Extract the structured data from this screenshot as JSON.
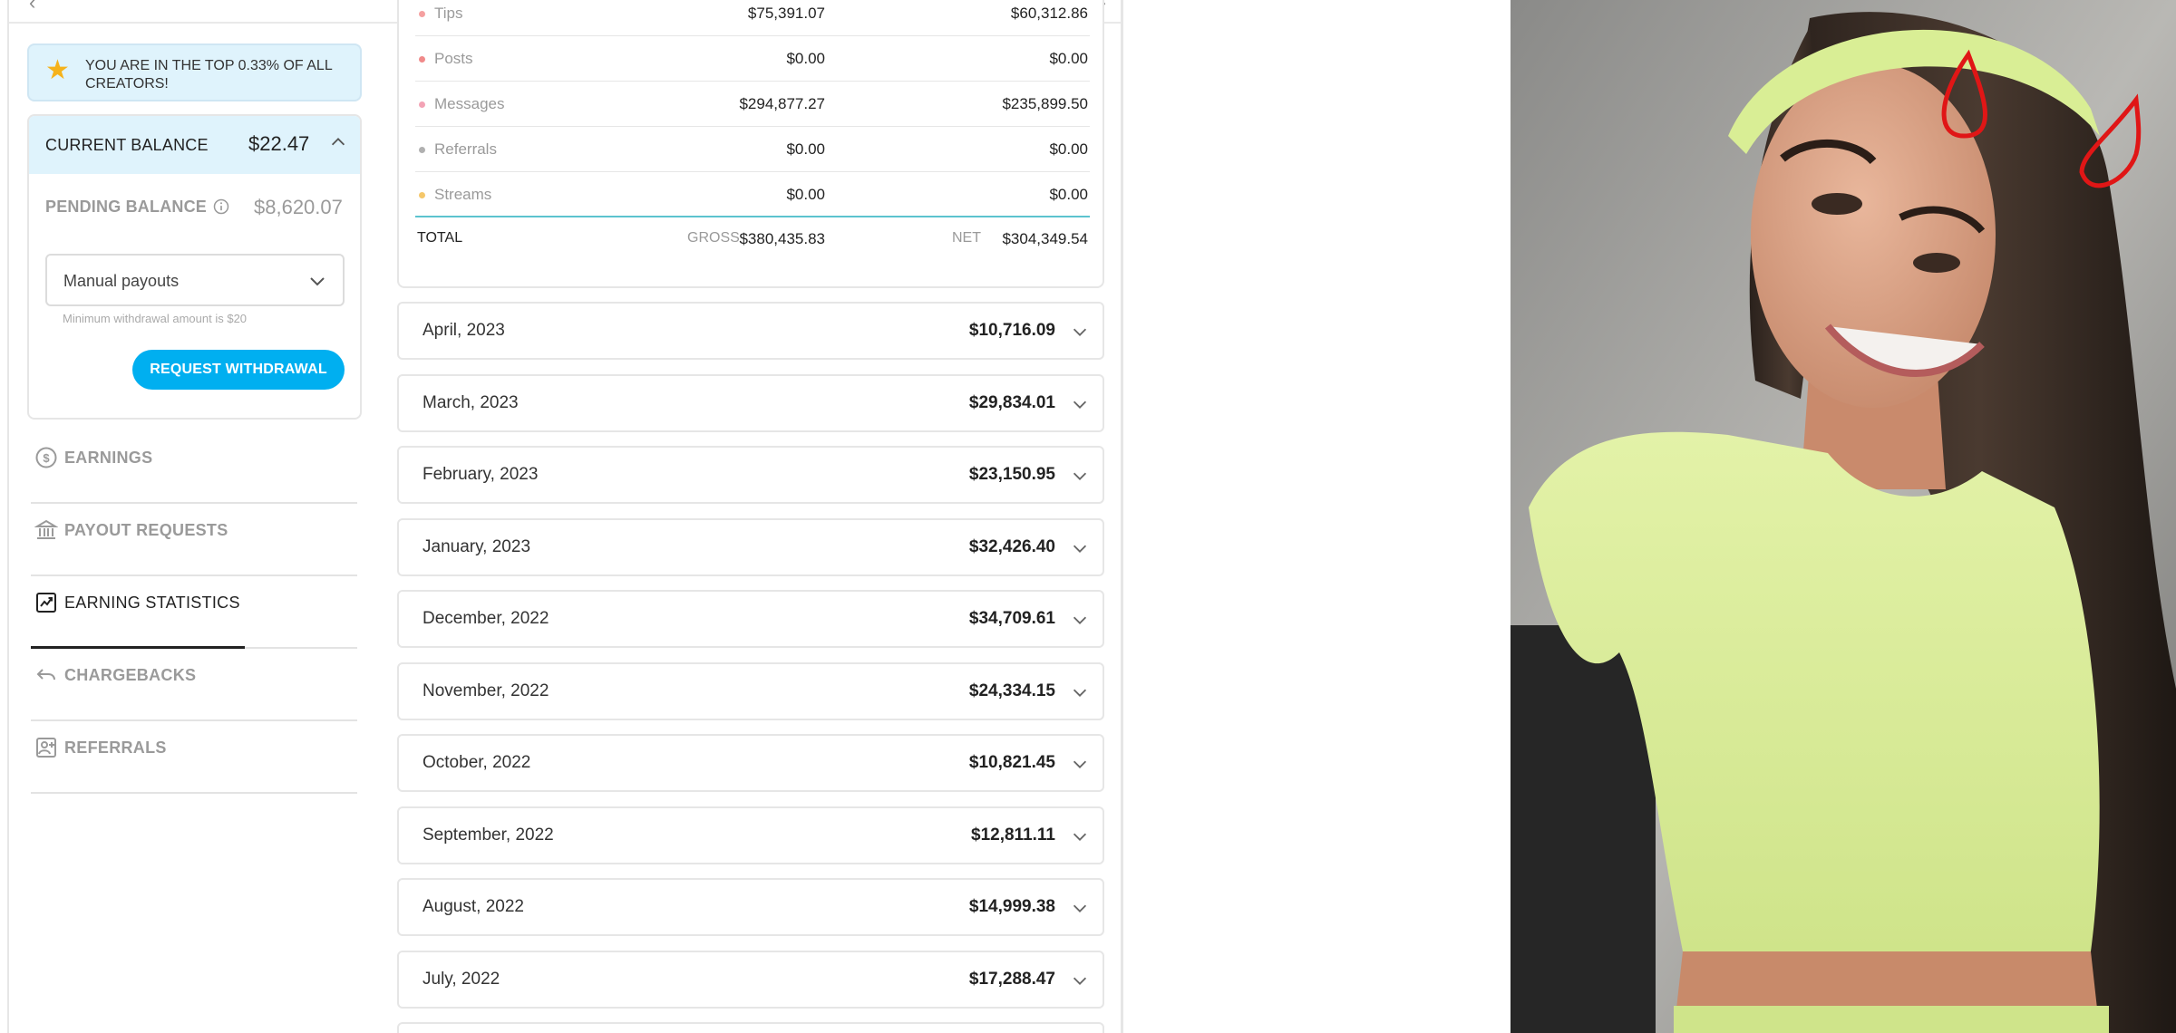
{
  "promo": {
    "text": "YOU ARE IN THE TOP 0.33% OF ALL CREATORS!"
  },
  "balance": {
    "current_label": "CURRENT BALANCE",
    "current_amount": "$22.47",
    "pending_label": "PENDING BALANCE",
    "pending_amount": "$8,620.07",
    "payout_mode": "Manual payouts",
    "min_hint": "Minimum withdrawal amount is $20",
    "withdraw_label": "REQUEST WITHDRAWAL"
  },
  "nav": [
    {
      "label": "EARNINGS",
      "icon": "dollar-circle-icon",
      "active": false
    },
    {
      "label": "PAYOUT REQUESTS",
      "icon": "bank-icon",
      "active": false
    },
    {
      "label": "EARNING STATISTICS",
      "icon": "chart-icon",
      "active": true
    },
    {
      "label": "CHARGEBACKS",
      "icon": "undo-icon",
      "active": false
    },
    {
      "label": "REFERRALS",
      "icon": "referral-icon",
      "active": false
    }
  ],
  "categories": [
    {
      "name": "Tips",
      "gross": "$75,391.07",
      "net": "$60,312.86",
      "dot_color": "#f5a0a0"
    },
    {
      "name": "Posts",
      "gross": "$0.00",
      "net": "$0.00",
      "dot_color": "#f08a8a"
    },
    {
      "name": "Messages",
      "gross": "$294,877.27",
      "net": "$235,899.50",
      "dot_color": "#f3a3b5"
    },
    {
      "name": "Referrals",
      "gross": "$0.00",
      "net": "$0.00",
      "dot_color": "#b0b0b0"
    },
    {
      "name": "Streams",
      "gross": "$0.00",
      "net": "$0.00",
      "dot_color": "#f5c76a"
    }
  ],
  "totals": {
    "label": "TOTAL",
    "gross_label": "GROSS",
    "gross": "$380,435.83",
    "net_label": "NET",
    "net": "$304,349.54"
  },
  "months": [
    {
      "name": "April, 2023",
      "amount": "$10,716.09"
    },
    {
      "name": "March, 2023",
      "amount": "$29,834.01"
    },
    {
      "name": "February, 2023",
      "amount": "$23,150.95"
    },
    {
      "name": "January, 2023",
      "amount": "$32,426.40"
    },
    {
      "name": "December, 2022",
      "amount": "$34,709.61"
    },
    {
      "name": "November, 2022",
      "amount": "$24,334.15"
    },
    {
      "name": "October, 2022",
      "amount": "$10,821.45"
    },
    {
      "name": "September, 2022",
      "amount": "$12,811.11"
    },
    {
      "name": "August, 2022",
      "amount": "$14,999.38"
    },
    {
      "name": "July, 2022",
      "amount": "$17,288.47"
    }
  ],
  "colors": {
    "accent": "#00aff0",
    "promo_bg": "#dff3fc",
    "divider_teal": "#5cc3cf"
  }
}
